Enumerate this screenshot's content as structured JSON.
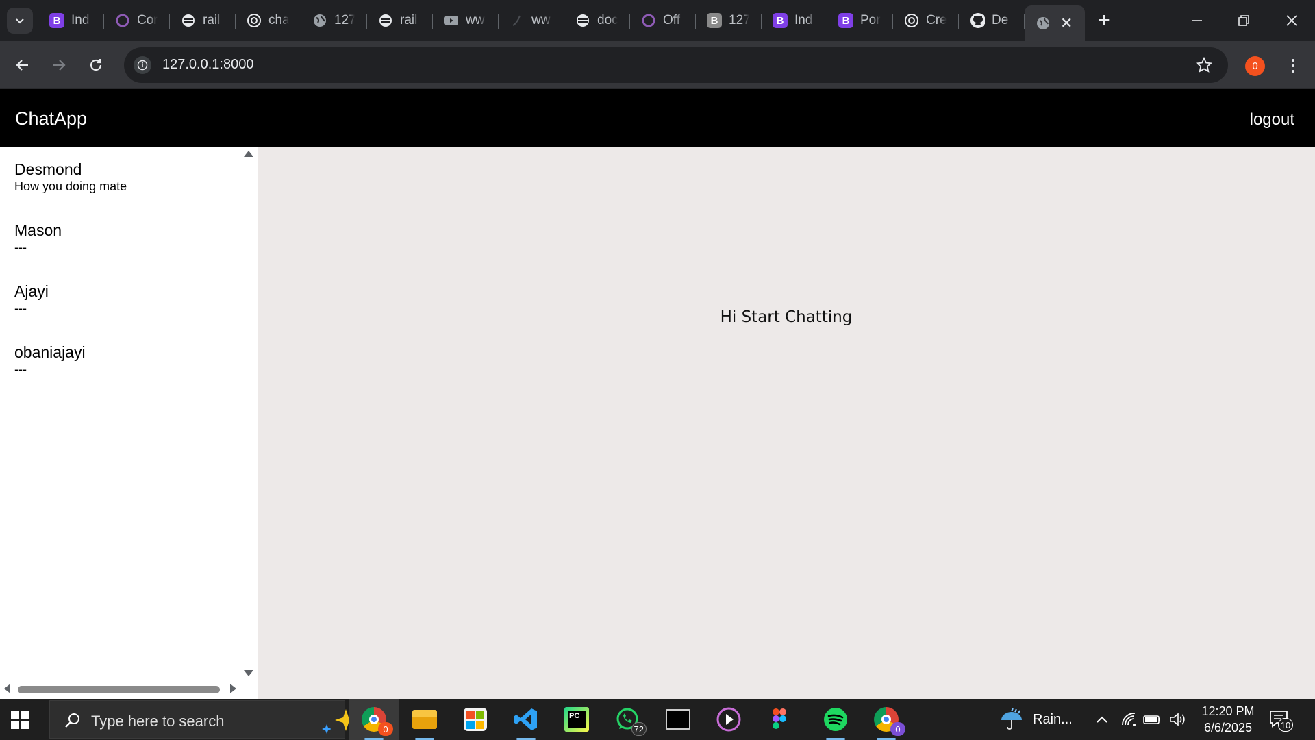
{
  "browser": {
    "tabs": [
      {
        "title": "Ind",
        "favicon_letter": "B",
        "favicon_color": "#7f3fe6"
      },
      {
        "title": "Cor",
        "favicon_letter": "",
        "favicon_color": "#6a3b8f"
      },
      {
        "title": "rail",
        "favicon_letter": "",
        "favicon_color": "#9aa0a6"
      },
      {
        "title": "cha",
        "favicon_letter": "",
        "favicon_color": "#9aa0a6"
      },
      {
        "title": "127",
        "favicon_letter": "",
        "favicon_color": "#9aa0a6"
      },
      {
        "title": "rail",
        "favicon_letter": "",
        "favicon_color": "#9aa0a6"
      },
      {
        "title": "ww",
        "favicon_letter": "",
        "favicon_color": "#9aa0a6"
      },
      {
        "title": "ww",
        "favicon_letter": "",
        "favicon_color": "#5f6368"
      },
      {
        "title": "doc",
        "favicon_letter": "",
        "favicon_color": "#9aa0a6"
      },
      {
        "title": "Off",
        "favicon_letter": "",
        "favicon_color": "#6a3b8f"
      },
      {
        "title": "127",
        "favicon_letter": "B",
        "favicon_color": "#8a8a8a"
      },
      {
        "title": "Ind",
        "favicon_letter": "B",
        "favicon_color": "#7f3fe6"
      },
      {
        "title": "Por",
        "favicon_letter": "B",
        "favicon_color": "#7f3fe6"
      },
      {
        "title": "Cre",
        "favicon_letter": "",
        "favicon_color": "#9aa0a6"
      },
      {
        "title": "De",
        "favicon_letter": "",
        "favicon_color": "#ffffff"
      }
    ],
    "active_tab": {
      "title": "",
      "close": "✕"
    },
    "new_tab": "+",
    "url": "127.0.0.1:8000",
    "profile_badge": "0"
  },
  "app": {
    "brand": "ChatApp",
    "logout": "logout",
    "conversations": [
      {
        "name": "Desmond",
        "preview": "How you doing mate"
      },
      {
        "name": "Mason",
        "preview": "---"
      },
      {
        "name": "Ajayi",
        "preview": "---"
      },
      {
        "name": "obaniajayi",
        "preview": "---"
      }
    ],
    "welcome": "Hi Start Chatting"
  },
  "taskbar": {
    "search_placeholder": "Type here to search",
    "weather": "Rain...",
    "time": "12:20 PM",
    "date": "6/6/2025",
    "notifications": "10",
    "chrome_badge": "0",
    "whatsapp_badge": "72",
    "chrome2_badge": "0"
  },
  "colors": {
    "header_bg": "#000000",
    "chat_area_bg": "#ede9e8",
    "profile_orange": "#f4511e"
  }
}
